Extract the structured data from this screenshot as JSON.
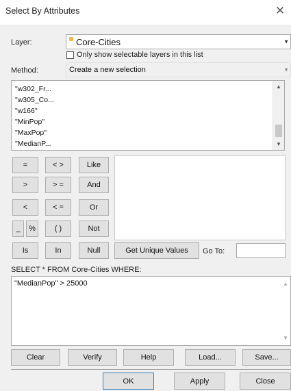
{
  "window": {
    "title": "Select By Attributes",
    "close_glyph": "✕"
  },
  "layer": {
    "label": "Layer:",
    "value": "Core-Cities",
    "only_selectable_label": "Only show selectable layers in this list",
    "only_selectable_checked": false
  },
  "method": {
    "label": "Method:",
    "value": "Create a new selection"
  },
  "fields": [
    "\"w302_Fr...",
    "\"w305_Co...",
    "\"w166\"",
    "\"MinPop\"",
    "\"MaxPop\"",
    "\"MedianP..."
  ],
  "operators": {
    "eq": "=",
    "ne": "< >",
    "like": "Like",
    "gt": ">",
    "ge": "> =",
    "and": "And",
    "lt": "<",
    "le": "< =",
    "or": "Or",
    "underscore": "_",
    "percent": "%",
    "parens": "( )",
    "not": "Not",
    "is": "Is",
    "in": "In",
    "null": "Null"
  },
  "unique_values_button": "Get Unique Values",
  "goto_label": "Go To:",
  "goto_value": "",
  "query": {
    "prefix": "SELECT * FROM Core-Cities WHERE:",
    "expression": "\"MedianPop\" > 25000"
  },
  "bottom_buttons": {
    "clear": "Clear",
    "verify": "Verify",
    "help": "Help",
    "load": "Load...",
    "save": "Save..."
  },
  "dialog_buttons": {
    "ok": "OK",
    "apply": "Apply",
    "close": "Close"
  }
}
